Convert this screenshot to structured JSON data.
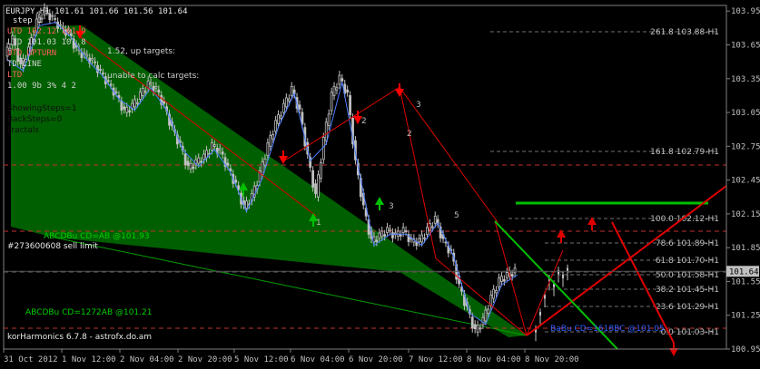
{
  "header": {
    "symbol_line": "EURJPY,H1  101.61 101.66 101.56 101.64",
    "step_line": "step 1",
    "overlay_lines": [
      "UTD 102.12  101.9",
      "LTD 101.03  101.8",
      "UTD UPTURN",
      "TD LINE",
      "LTD"
    ],
    "target_text_1": "1.52, up targets:",
    "target_text_2": "unable to calc targets:",
    "lot_text": "1.00 9b 3% 4 2"
  },
  "settings_text": [
    "ShowingSteps=1",
    "BackSteps=0",
    "Fractals"
  ],
  "fib_labels": [
    {
      "text": "261.8 103.88-H1",
      "color": "#c0c0c0"
    },
    {
      "text": "161.8 102.79-H1",
      "color": "#c0c0c0"
    },
    {
      "text": "100.0 102.12-H1",
      "color": "#c0c0c0"
    },
    {
      "text": "78.6 101.89-H1",
      "color": "#c0c0c0"
    },
    {
      "text": "61.8 101.70-H1",
      "color": "#c0c0c0"
    },
    {
      "text": "50.0 101.58-H1",
      "color": "#c0c0c0"
    },
    {
      "text": "38.2 101.45-H1",
      "color": "#c0c0c0"
    },
    {
      "text": "23.6 101.29-H1",
      "color": "#c0c0c0"
    },
    {
      "text": "0.0 101.03-H1",
      "color": "#c0c0c0"
    }
  ],
  "pattern_labels": {
    "abcd_1": "ABCDBu CD=AB   @101.93",
    "sell_limit": "#273600608 sell limit",
    "abcd_2": "ABCDBu CD=1272AB   @101.21",
    "abcd_3": "BaBu CD=1618BC   @101.05"
  },
  "point_labels": [
    "1",
    "2",
    "3",
    "2",
    "3",
    "5"
  ],
  "footer": "korHarmonics 6.7.8 - astrofx.do.am",
  "price_badge": "101.64",
  "colors": {
    "background": "#000000",
    "bull_candle": "#c0c0c0",
    "zigzag_green": "#006400",
    "line_red": "#e00000",
    "fractal_up": "#00c000",
    "fractal_down": "#ff0000",
    "wave_blue": "#4d7dff",
    "accent_green": "#00bf00"
  },
  "chart_data": {
    "type": "candlestick",
    "symbol": "EURJPY",
    "timeframe": "H1",
    "ylim": [
      100.95,
      104.0
    ],
    "y_ticks": [
      103.95,
      103.65,
      103.35,
      103.05,
      102.75,
      102.45,
      102.15,
      101.85,
      101.55,
      101.25,
      100.95
    ],
    "x_ticks": [
      "31 Oct 2012",
      "1 Nov 12:00",
      "2 Nov 04:00",
      "2 Nov 20:00",
      "5 Nov 12:00",
      "6 Nov 04:00",
      "6 Nov 20:00",
      "7 Nov 12:00",
      "8 Nov 04:00",
      "8 Nov 20:00"
    ],
    "last_price": 101.64,
    "fib_levels": [
      103.88,
      102.79,
      102.12,
      101.89,
      101.7,
      101.58,
      101.45,
      101.29,
      101.03
    ],
    "close_path": [
      103.55,
      103.7,
      103.45,
      103.6,
      103.85,
      103.95,
      103.88,
      103.8,
      103.75,
      103.6,
      103.55,
      103.5,
      103.4,
      103.3,
      103.2,
      103.05,
      103.1,
      103.2,
      103.3,
      103.25,
      103.1,
      102.9,
      102.75,
      102.55,
      102.6,
      102.65,
      102.75,
      102.7,
      102.55,
      102.4,
      102.2,
      102.3,
      102.5,
      102.75,
      102.95,
      103.1,
      103.25,
      103.05,
      102.65,
      102.3,
      102.8,
      103.2,
      103.35,
      103.2,
      102.6,
      102.2,
      101.9,
      101.95,
      102.0,
      101.95,
      102.0,
      101.9,
      101.9,
      102.0,
      102.1,
      101.9,
      101.8,
      101.5,
      101.3,
      101.1,
      101.2,
      101.4,
      101.55,
      101.6,
      101.64
    ]
  }
}
